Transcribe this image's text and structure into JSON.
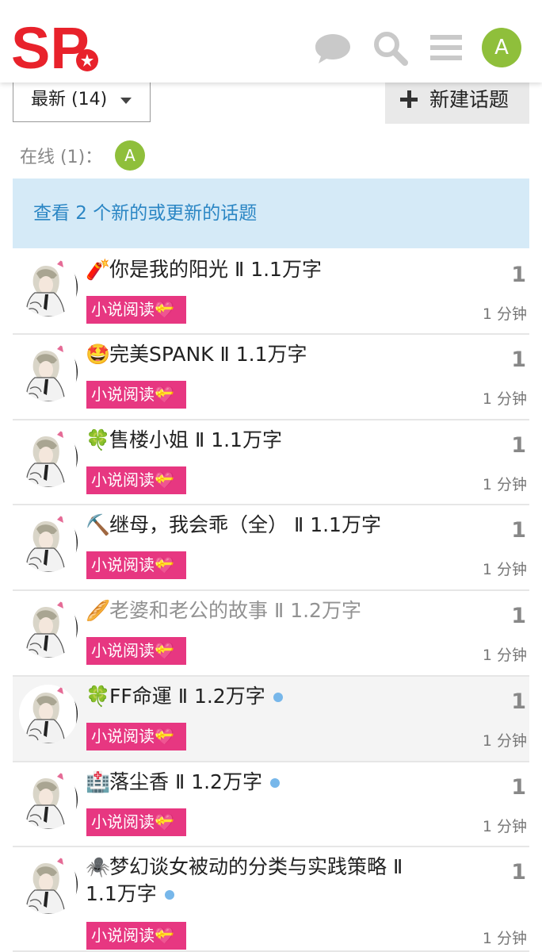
{
  "header": {
    "logo_text": "SP",
    "user_initial": "A",
    "icons": [
      "chat-icon",
      "search-icon",
      "menu-icon"
    ]
  },
  "controls": {
    "filter_label": "最新 (14)",
    "new_topic_label": "新建话题"
  },
  "online": {
    "label": "在线 (1)：",
    "user_initial": "A"
  },
  "notice": "查看 2 个新的或更新的话题",
  "topics": [
    {
      "emoji": "🧨",
      "title": "你是我的阳光 Ⅱ 1.1万字",
      "tag": "小说阅读💝",
      "replies": "1",
      "age": "1 分钟",
      "visited": false,
      "new": false
    },
    {
      "emoji": "🤩",
      "title": "完美SPANK Ⅱ 1.1万字",
      "tag": "小说阅读💝",
      "replies": "1",
      "age": "1 分钟",
      "visited": false,
      "new": false
    },
    {
      "emoji": "🍀",
      "title": "售楼小姐 Ⅱ 1.1万字",
      "tag": "小说阅读💝",
      "replies": "1",
      "age": "1 分钟",
      "visited": false,
      "new": false
    },
    {
      "emoji": "⛏️",
      "title": "继母，我会乖（全） Ⅱ 1.1万字",
      "tag": "小说阅读💝",
      "replies": "1",
      "age": "1 分钟",
      "visited": false,
      "new": false
    },
    {
      "emoji": "🥖",
      "title": "老婆和老公的故事 Ⅱ 1.2万字",
      "tag": "小说阅读💝",
      "replies": "1",
      "age": "1 分钟",
      "visited": true,
      "new": false
    },
    {
      "emoji": "🍀",
      "title": "FF命運 Ⅱ 1.2万字",
      "tag": "小说阅读💝",
      "replies": "1",
      "age": "1 分钟",
      "visited": false,
      "new": true
    },
    {
      "emoji": "🏥",
      "title": "落尘香 Ⅱ 1.2万字",
      "tag": "小说阅读💝",
      "replies": "1",
      "age": "1 分钟",
      "visited": false,
      "new": true
    },
    {
      "emoji": "🕷️",
      "title": "梦幻谈女被动的分类与实践策略 Ⅱ 1.1万字",
      "tag": "小说阅读💝",
      "replies": "1",
      "age": "1 分钟",
      "visited": false,
      "new": true
    }
  ]
}
